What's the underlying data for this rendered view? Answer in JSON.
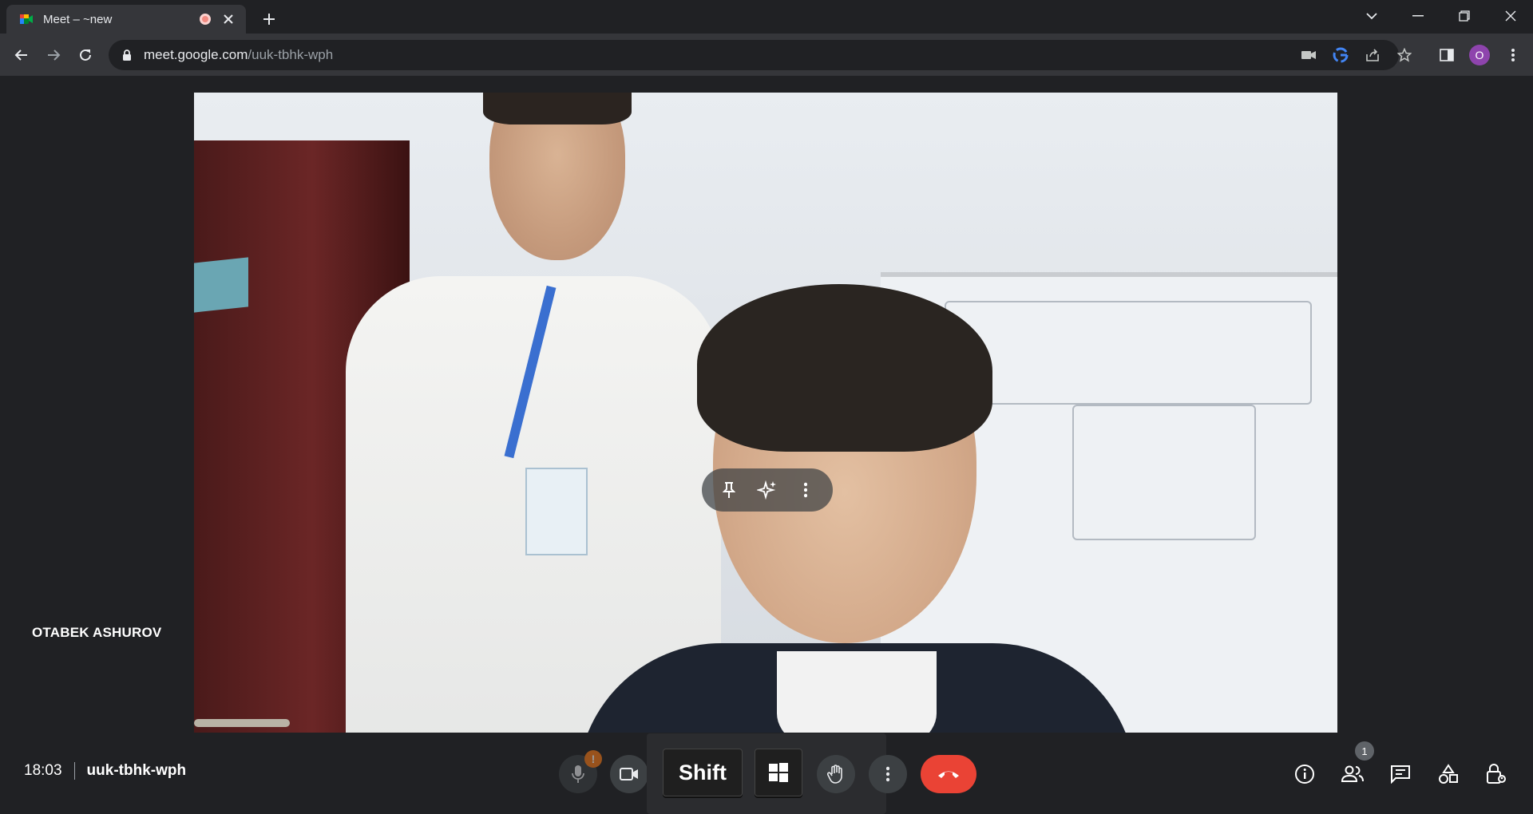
{
  "browser": {
    "tab": {
      "title": "Meet – ~new",
      "favicon": "google-meet-icon",
      "recording_indicator": "recording-dot-icon",
      "close": "close-icon"
    },
    "new_tab": "plus-icon",
    "window_controls": [
      "tab-search-icon",
      "minimize-icon",
      "restore-icon",
      "close-icon"
    ],
    "nav": {
      "back": "arrow-left-icon",
      "forward": "arrow-right-icon",
      "reload": "reload-icon"
    },
    "url": {
      "host": "meet.google.com",
      "path": "/uuk-tbhk-wph"
    },
    "omnibox_icons": [
      "camera-in-use-icon",
      "google-icon",
      "share-icon",
      "star-icon"
    ],
    "profile_initial": "O"
  },
  "meet": {
    "participant_name": "OTABEK ASHUROV",
    "tile_menu": [
      "pin-icon",
      "sparkle-effects-icon",
      "more-vert-icon"
    ],
    "clock": "18:03",
    "meeting_code": "uuk-tbhk-wph",
    "controls": {
      "mic": "mic-icon",
      "mic_badge": "!",
      "camera": "video-camera-icon",
      "raise_hand": "hand-icon",
      "more": "more-vert-icon",
      "end_call": "phone-hangup-icon",
      "end_call_color": "#ea4335"
    },
    "right_controls": {
      "info": "info-icon",
      "people": "people-icon",
      "people_count": "1",
      "chat": "chat-icon",
      "activities": "shapes-icon",
      "host_controls": "lock-person-icon"
    }
  },
  "on_screen_keyboard": {
    "shift_label": "Shift",
    "win_key": "windows-logo-icon"
  }
}
